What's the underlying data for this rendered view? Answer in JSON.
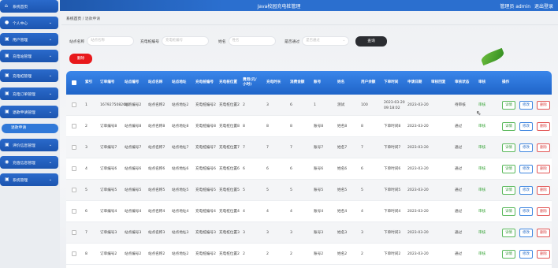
{
  "header": {
    "title": "Java校园充电桩管理",
    "user_label": "管理员 admin",
    "logout": "退出登录"
  },
  "sidebar": {
    "items": [
      {
        "label": "系统首页",
        "icon": "home-icon",
        "glyph": "⌂"
      },
      {
        "label": "个人中心",
        "icon": "person-icon",
        "glyph": "●"
      },
      {
        "label": "用户管理",
        "icon": "users-icon",
        "glyph": "▣"
      },
      {
        "label": "充电站管理",
        "icon": "station-icon",
        "glyph": "▣"
      },
      {
        "label": "充电桩管理",
        "icon": "charger-icon",
        "glyph": "▣"
      },
      {
        "label": "充电订单管理",
        "icon": "order-icon",
        "glyph": "▣"
      },
      {
        "label": "退款申请管理",
        "icon": "refund-icon",
        "glyph": "▣"
      },
      {
        "label": "评价信息管理",
        "icon": "review-icon",
        "glyph": "▣"
      },
      {
        "label": "充值信息管理",
        "icon": "recharge-icon",
        "glyph": "◉"
      },
      {
        "label": "系统管理",
        "icon": "settings-icon",
        "glyph": "▣"
      }
    ],
    "active_sub": "退款申请"
  },
  "breadcrumb": {
    "home": "系统首页",
    "sep": "/",
    "current": "退款申请"
  },
  "filters": {
    "station_no": {
      "label": "站点名称",
      "placeholder": "站点名称"
    },
    "pile_no": {
      "label": "充电桩编号",
      "placeholder": "充电桩编号"
    },
    "name": {
      "label": "姓名",
      "placeholder": "姓名"
    },
    "approved": {
      "label": "是否通过",
      "placeholder": "是否通过"
    },
    "search_button": "查询"
  },
  "delete_button": "删除",
  "table": {
    "columns": [
      "索引",
      "订单编号",
      "站点编号",
      "站点名称",
      "站点地址",
      "充电桩编号",
      "充电桩位置",
      "费用(元/小时)",
      "充电时长",
      "消费金额",
      "账号",
      "姓名",
      "用户余额",
      "下单时间",
      "申请日期",
      "审核回复",
      "审核状态",
      "审核",
      "操作"
    ],
    "rows": [
      {
        "idx": "1",
        "order": "1679275082641",
        "sno": "站点编号2",
        "sname": "站点名称2",
        "saddr": "站点地址2",
        "pile": "充电桩编号2",
        "pos": "充电桩位置2",
        "fee": "2",
        "dur": "3",
        "amt": "6",
        "acct": "1",
        "name": "测试",
        "bal": "100",
        "otime": "2023-03-20 09:18:02",
        "adate": "2023-03-20",
        "reply": "",
        "status": "待审核",
        "audit": "审核"
      },
      {
        "idx": "2",
        "order": "订单编号8",
        "sno": "站点编号8",
        "sname": "站点名称8",
        "saddr": "站点地址8",
        "pile": "充电桩编号8",
        "pos": "充电桩位置8",
        "fee": "8",
        "dur": "8",
        "amt": "8",
        "acct": "账号8",
        "name": "姓名8",
        "bal": "8",
        "otime": "下单时间8",
        "adate": "2023-03-20",
        "reply": "",
        "status": "通过",
        "audit": "审核"
      },
      {
        "idx": "3",
        "order": "订单编号7",
        "sno": "站点编号7",
        "sname": "站点名称7",
        "saddr": "站点地址7",
        "pile": "充电桩编号7",
        "pos": "充电桩位置7",
        "fee": "7",
        "dur": "7",
        "amt": "7",
        "acct": "账号7",
        "name": "姓名7",
        "bal": "7",
        "otime": "下单时间7",
        "adate": "2023-03-20",
        "reply": "",
        "status": "通过",
        "audit": "审核"
      },
      {
        "idx": "4",
        "order": "订单编号6",
        "sno": "站点编号6",
        "sname": "站点名称6",
        "saddr": "站点地址6",
        "pile": "充电桩编号6",
        "pos": "充电桩位置6",
        "fee": "6",
        "dur": "6",
        "amt": "6",
        "acct": "账号6",
        "name": "姓名6",
        "bal": "6",
        "otime": "下单时间6",
        "adate": "2023-03-20",
        "reply": "",
        "status": "通过",
        "audit": "审核"
      },
      {
        "idx": "5",
        "order": "订单编号5",
        "sno": "站点编号5",
        "sname": "站点名称5",
        "saddr": "站点地址5",
        "pile": "充电桩编号5",
        "pos": "充电桩位置5",
        "fee": "5",
        "dur": "5",
        "amt": "5",
        "acct": "账号5",
        "name": "姓名5",
        "bal": "5",
        "otime": "下单时间5",
        "adate": "2023-03-20",
        "reply": "",
        "status": "通过",
        "audit": "审核"
      },
      {
        "idx": "6",
        "order": "订单编号4",
        "sno": "站点编号4",
        "sname": "站点名称4",
        "saddr": "站点地址4",
        "pile": "充电桩编号4",
        "pos": "充电桩位置4",
        "fee": "4",
        "dur": "4",
        "amt": "4",
        "acct": "账号4",
        "name": "姓名4",
        "bal": "4",
        "otime": "下单时间4",
        "adate": "2023-03-20",
        "reply": "",
        "status": "通过",
        "audit": "审核"
      },
      {
        "idx": "7",
        "order": "订单编号3",
        "sno": "站点编号3",
        "sname": "站点名称3",
        "saddr": "站点地址3",
        "pile": "充电桩编号3",
        "pos": "充电桩位置3",
        "fee": "3",
        "dur": "3",
        "amt": "3",
        "acct": "账号3",
        "name": "姓名3",
        "bal": "3",
        "otime": "下单时间3",
        "adate": "2023-03-20",
        "reply": "",
        "status": "通过",
        "audit": "审核"
      },
      {
        "idx": "8",
        "order": "订单编号2",
        "sno": "站点编号2",
        "sname": "站点名称2",
        "saddr": "站点地址2",
        "pile": "充电桩编号2",
        "pos": "充电桩位置2",
        "fee": "2",
        "dur": "2",
        "amt": "2",
        "acct": "账号2",
        "name": "姓名2",
        "bal": "2",
        "otime": "下单时间2",
        "adate": "2023-03-20",
        "reply": "",
        "status": "通过",
        "audit": "审核"
      }
    ],
    "actions": {
      "detail": "详情",
      "edit": "修改",
      "delete": "删除"
    }
  },
  "colors": {
    "primary": "#2b6fcf",
    "danger": "#e8191c",
    "success": "#2fa02f",
    "dark": "#2b2d31"
  }
}
